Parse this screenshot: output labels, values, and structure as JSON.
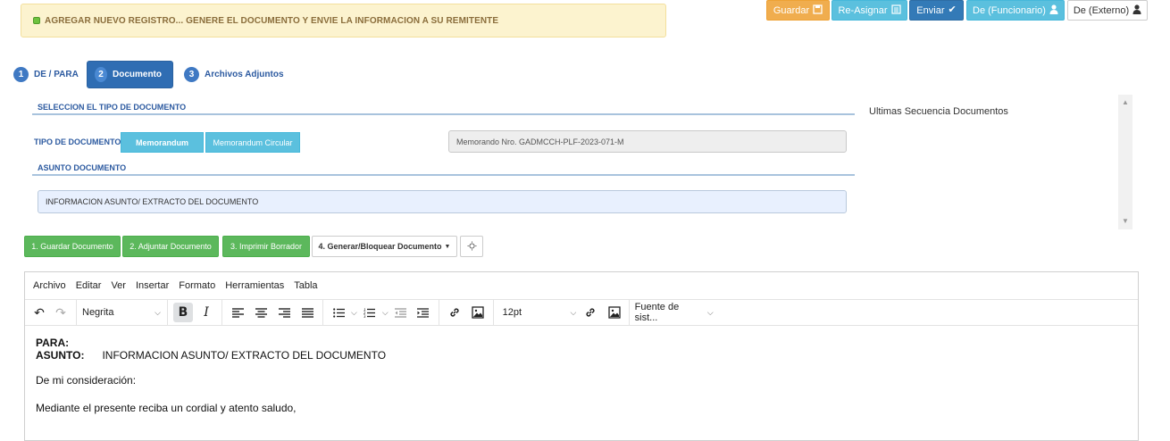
{
  "alert": {
    "text": "AGREGAR NUEVO REGISTRO... GENERE EL DOCUMENTO Y ENVIE LA INFORMACION A SU REMITENTE"
  },
  "top_buttons": {
    "guardar": "Guardar",
    "reasignar": "Re-Asignar",
    "enviar": "Enviar",
    "de_funcionario": "De (Funcionario)",
    "de_externo": "De (Externo)"
  },
  "steps": [
    {
      "num": "1",
      "label": "DE / PARA"
    },
    {
      "num": "2",
      "label": "Documento"
    },
    {
      "num": "3",
      "label": "Archivos Adjuntos"
    }
  ],
  "form": {
    "section_tipo": "SELECCION EL TIPO DE DOCUMENTO",
    "tipo_label": "TIPO DE DOCUMENTO",
    "tipo_options": [
      "Memorandum",
      "Memorandum Circular"
    ],
    "secuencia_value": "Memorando Nro. GADMCCH-PLF-2023-071-M",
    "section_asunto": "ASUNTO DOCUMENTO",
    "asunto_value": "INFORMACION ASUNTO/ EXTRACTO DEL DOCUMENTO"
  },
  "side": {
    "title": "Ultimas Secuencia Documentos"
  },
  "actions": {
    "guardar_doc": "1. Guardar Documento",
    "adjuntar_doc": "2. Adjuntar Documento",
    "imprimir": "3. Imprimir Borrador",
    "generar": "4. Generar/Bloquear Documento"
  },
  "editor": {
    "menu": [
      "Archivo",
      "Editar",
      "Ver",
      "Insertar",
      "Formato",
      "Herramientas",
      "Tabla"
    ],
    "block_format": "Negrita",
    "font_size": "12pt",
    "font_family": "Fuente de sist...",
    "content": {
      "para_label": "PARA:",
      "asunto_label": "ASUNTO:",
      "asunto_text": "INFORMACION ASUNTO/ EXTRACTO DEL DOCUMENTO",
      "greeting": "De mi consideración:",
      "body": "Mediante el presente reciba un cordial y atento saludo,"
    }
  },
  "colors": {
    "alert_bg": "#fcf3cf",
    "warning": "#f0ad4e",
    "info": "#5bc0de",
    "primary": "#337ab7",
    "success": "#5cb85c"
  }
}
